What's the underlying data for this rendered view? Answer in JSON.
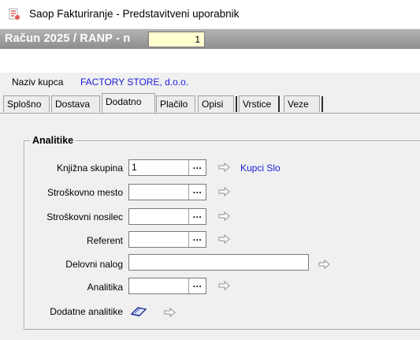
{
  "window": {
    "title": "Saop Fakturiranje - Predstavitveni uporabnik"
  },
  "document": {
    "title": "Račun  2025 / RANP - n",
    "number": "1"
  },
  "customer": {
    "label": "Naziv kupca",
    "value": "FACTORY STORE, d.o.o."
  },
  "tabs": [
    {
      "label": "Splošno"
    },
    {
      "label": "Dostava"
    },
    {
      "label": "Dodatno",
      "active": true
    },
    {
      "label": "Plačilo"
    },
    {
      "label": "Opisi"
    },
    {
      "label": "Vrstice"
    },
    {
      "label": "Veze"
    }
  ],
  "analitike": {
    "title": "Analitike",
    "fields": [
      {
        "label": "Knjižna skupina",
        "value": "1",
        "link": "Kupci Slo"
      },
      {
        "label": "Stroškovno mesto",
        "value": ""
      },
      {
        "label": "Stroškovni  nosilec",
        "value": ""
      },
      {
        "label": "Referent",
        "value": ""
      },
      {
        "label": "Delovni nalog",
        "value": ""
      },
      {
        "label": "Analitika",
        "value": ""
      }
    ],
    "extra_label": "Dodatne analitike",
    "browse_button": "..."
  },
  "icons": {
    "app": "app-icon",
    "browse": "ellipsis-icon",
    "jump": "hand-pointer-icon",
    "extra": "book-icon"
  },
  "colors": {
    "link": "#1a1ad8",
    "header_gradient_top": "#b4b4b4",
    "header_gradient_bottom": "#8d8d8d",
    "number_bg": "#ffffd0"
  }
}
